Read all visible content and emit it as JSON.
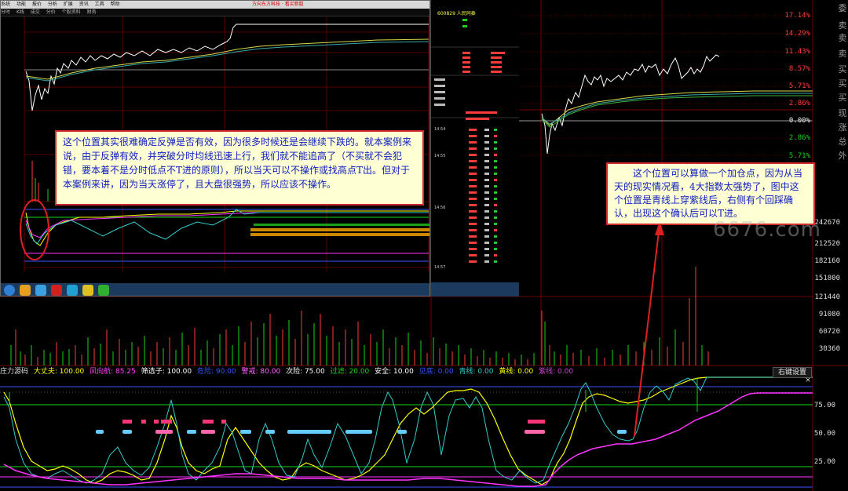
{
  "colors": {
    "background": "#000000",
    "up": "#ff3b3b",
    "down": "#19d219",
    "ma_yellow": "#ffff00",
    "ma_white": "#ffffff",
    "ma_magenta": "#ff33ff",
    "ma_cyan": "#33cccc",
    "note_bg": "#ffffd4",
    "note_border": "#d12a2a",
    "note_text": "#1020c0"
  },
  "price_axis": {
    "labels": [
      "17.14%",
      "14.29%",
      "11.43%",
      "8.57%",
      "5.71%",
      "2.86%",
      "0.00%",
      "2.86%",
      "5.71%"
    ],
    "colors": [
      "up",
      "up",
      "up",
      "up",
      "up",
      "up",
      "flat",
      "down",
      "down"
    ]
  },
  "side_chars": [
    "委",
    "卖",
    "卖",
    "卖",
    "买",
    "买",
    "买",
    "现",
    "涨",
    "总",
    "外"
  ],
  "volume_axis": {
    "labels": [
      "242670",
      "212520",
      "182160",
      "151800",
      "121440",
      "91080",
      "60720",
      "30360"
    ]
  },
  "oscillator_axis": {
    "labels": [
      "75.00",
      "50.00",
      "25.00"
    ]
  },
  "indicator_bar": {
    "name": "庄力源码",
    "items": [
      {
        "text": "大丈夫: 100.00",
        "color": "#ffff00"
      },
      {
        "text": "凤向航: 85.25",
        "color": "#ff44ff"
      },
      {
        "text": "筛选子: 100.00",
        "color": "#ffffff"
      },
      {
        "text": "危险: 90.00",
        "color": "#3355ff"
      },
      {
        "text": "警戒: 80.00",
        "color": "#ff66ff"
      },
      {
        "text": "次险: 75.00",
        "color": "#ffffff"
      },
      {
        "text": "过滤: 20.00",
        "color": "#19d219"
      },
      {
        "text": "安全: 10.00",
        "color": "#ffffff"
      },
      {
        "text": "见底: 0.00",
        "color": "#3355ff"
      },
      {
        "text": "青线: 0.00",
        "color": "#33cccc"
      },
      {
        "text": "黄线: 0.00",
        "color": "#ffff00"
      },
      {
        "text": "紫线: 0.00",
        "color": "#cc44cc"
      }
    ],
    "right_button": "右键设置",
    "close": "×"
  },
  "inset": {
    "menu": [
      "系统",
      "功能",
      "报价",
      "分析",
      "扩展",
      "资讯",
      "工具",
      "帮助"
    ],
    "window_title": "方向东方科技 · 看买新股",
    "tabs": [
      "分时",
      "K线",
      "成交",
      "分价",
      "个股资料",
      "财务"
    ],
    "quote_title": "600829 人民同泰",
    "time_labels": [
      "14:54",
      "14:55",
      "14:56",
      "14:57"
    ]
  },
  "note_left": {
    "text": "这个位置其实很难确定反弹是否有效，因为很多时候还是会继续下跌的。就本案例来说，由于反弹有效，并突破分时均线迅速上行，我们就不能追高了（不买就不会犯错，要本着不是分时低点不T进的原则），所以当天可以不操作或找高点T出。但对于本案例来讲，因为当天涨停了，且大盘很强势，所以应该不操作。"
  },
  "note_right": {
    "text": "这个位置可以算做一个加仓点，因为从当天的现实情况看，4大指数太强势了，图中这个位置是青线上穿紫线后，右侧有个回踩确认，出现这个确认后可以T进。"
  },
  "watermark": "6676.com"
}
